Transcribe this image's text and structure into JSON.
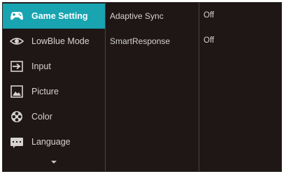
{
  "menu": {
    "items": [
      {
        "label": "Game Setting",
        "icon": "gamepad-icon",
        "selected": true
      },
      {
        "label": "LowBlue Mode",
        "icon": "eye-icon",
        "selected": false
      },
      {
        "label": "Input",
        "icon": "input-arrow-icon",
        "selected": false
      },
      {
        "label": "Picture",
        "icon": "picture-icon",
        "selected": false
      },
      {
        "label": "Color",
        "icon": "color-palette-icon",
        "selected": false
      },
      {
        "label": "Language",
        "icon": "keyboard-icon",
        "selected": false
      }
    ],
    "more_indicator": "chevron-down-icon"
  },
  "submenu": {
    "items": [
      {
        "label": "Adaptive Sync"
      },
      {
        "label": "SmartResponse"
      }
    ]
  },
  "values": {
    "items": [
      {
        "label": "Off"
      },
      {
        "label": "Off"
      }
    ]
  },
  "colors": {
    "background": "#1e1716",
    "accent": "#18a4b1",
    "text": "#d6d2d1"
  }
}
